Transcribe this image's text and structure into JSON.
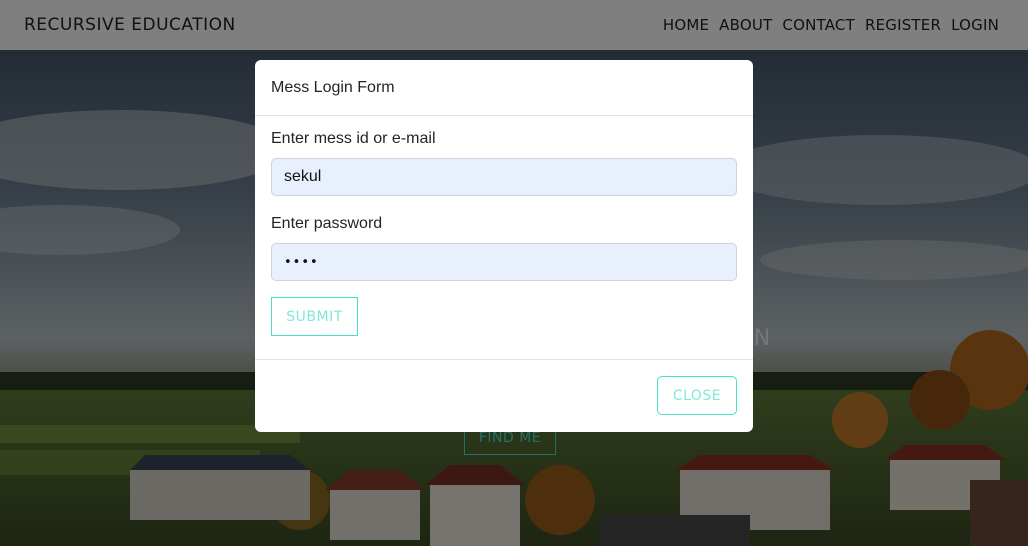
{
  "navbar": {
    "brand": "RECURSIVE EDUCATION",
    "links": [
      "HOME",
      "ABOUT",
      "CONTACT",
      "REGISTER",
      "LOGIN"
    ]
  },
  "hero": {
    "title_fragment": "N",
    "button_label": "FIND ME"
  },
  "modal": {
    "title": "Mess Login Form",
    "id_label": "Enter mess id or e-mail",
    "id_value": "sekul",
    "password_label": "Enter password",
    "password_value": "••••",
    "submit_label": "SUBMIT",
    "close_label": "CLOSE"
  },
  "colors": {
    "accent": "#47e0c8",
    "input_bg": "#e8f0fe"
  }
}
